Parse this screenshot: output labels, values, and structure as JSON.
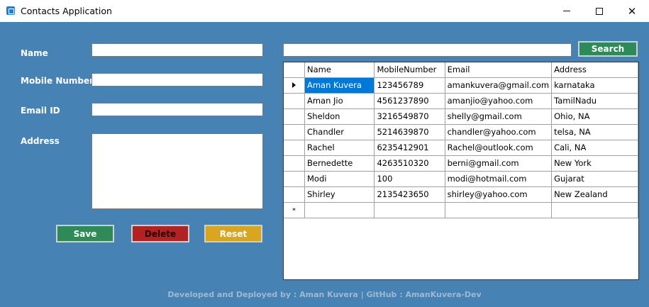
{
  "window": {
    "title": "Contacts Application",
    "icon": "app-icon",
    "controls": {
      "minimize_icon": "minimize-icon",
      "maximize_icon": "maximize-icon",
      "close_glyph": "✕"
    }
  },
  "form": {
    "name_label": "Name",
    "mobile_label": "Mobile Number",
    "email_label": "Email ID",
    "address_label": "Address",
    "name_value": "",
    "mobile_value": "",
    "email_value": "",
    "address_value": ""
  },
  "buttons": {
    "save": "Save",
    "delete": "Delete",
    "reset": "Reset",
    "search": "Search"
  },
  "search": {
    "value": ""
  },
  "grid": {
    "columns": [
      "Name",
      "MobileNumber",
      "Email",
      "Address"
    ],
    "rows": [
      [
        "Aman Kuvera",
        "123456789",
        "amankuvera@gmail.com",
        "karnataka"
      ],
      [
        "Aman Jio",
        "4561237890",
        "amanjio@yahoo.com",
        "TamilNadu"
      ],
      [
        "Sheldon",
        "3216549870",
        "shelly@gmail.com",
        "Ohio, NA"
      ],
      [
        "Chandler",
        "5214639870",
        "chandler@yahoo.com",
        "telsa, NA"
      ],
      [
        "Rachel",
        "6235412901",
        "Rachel@outlook.com",
        "Cali, NA"
      ],
      [
        "Bernedette",
        "4263510320",
        "berni@gmail.com",
        "New York"
      ],
      [
        "Modi",
        "100",
        "modi@hotmail.com",
        "Gujarat"
      ],
      [
        "Shirley",
        "2135423650",
        "shirley@yahoo.com",
        "New Zealand"
      ]
    ],
    "new_row_marker": "*"
  },
  "footer": {
    "text": "Developed and Deployed by : Aman Kuvera | GitHub : AmanKuvera-Dev"
  },
  "colors": {
    "background": "#4682b4",
    "save": "#2e8b57",
    "delete": "#b22222",
    "reset": "#daa520",
    "selection": "#0078d7"
  }
}
